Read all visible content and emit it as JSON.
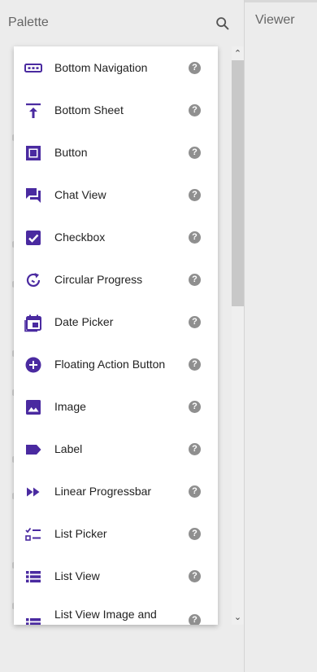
{
  "palette": {
    "title": "Palette",
    "search_icon": "search-icon"
  },
  "viewer": {
    "title": "Viewer"
  },
  "colors": {
    "accent": "#4a2aa0",
    "help": "#8f8f8f",
    "background": "#ececec"
  },
  "components": [
    {
      "label": "Bottom Navigation",
      "icon": "bottom-navigation-icon",
      "help": "?"
    },
    {
      "label": "Bottom Sheet",
      "icon": "bottom-sheet-icon",
      "help": "?"
    },
    {
      "label": "Button",
      "icon": "button-icon",
      "help": "?"
    },
    {
      "label": "Chat View",
      "icon": "chat-view-icon",
      "help": "?"
    },
    {
      "label": "Checkbox",
      "icon": "checkbox-icon",
      "help": "?"
    },
    {
      "label": "Circular Progress",
      "icon": "circular-progress-icon",
      "help": "?"
    },
    {
      "label": "Date Picker",
      "icon": "date-picker-icon",
      "help": "?"
    },
    {
      "label": "Floating Action Button",
      "icon": "floating-action-button-icon",
      "help": "?"
    },
    {
      "label": "Image",
      "icon": "image-icon",
      "help": "?"
    },
    {
      "label": "Label",
      "icon": "label-icon",
      "help": "?"
    },
    {
      "label": "Linear Progressbar",
      "icon": "linear-progressbar-icon",
      "help": "?"
    },
    {
      "label": "List Picker",
      "icon": "list-picker-icon",
      "help": "?"
    },
    {
      "label": "List View",
      "icon": "list-view-icon",
      "help": "?"
    },
    {
      "label": "List View Image and",
      "icon": "list-view-image-icon",
      "help": "?"
    }
  ],
  "scroll": {
    "up": "⌃",
    "down": "⌄"
  }
}
